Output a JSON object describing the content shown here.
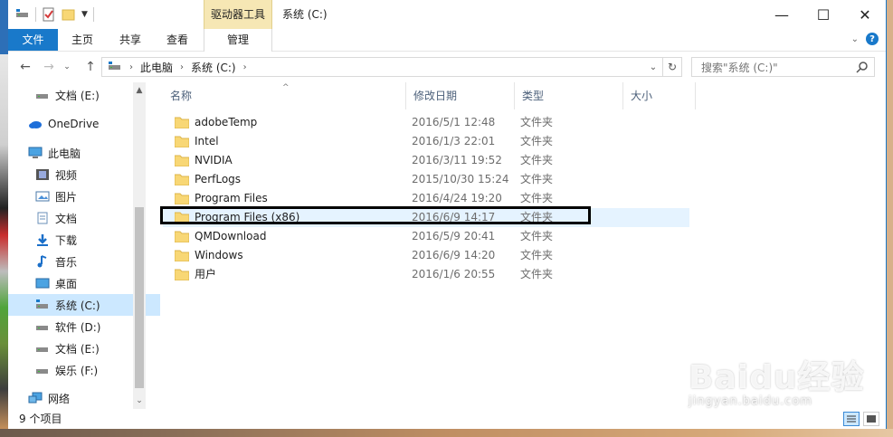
{
  "window": {
    "title": "系统 (C:)",
    "context_tool_label": "驱动器工具",
    "buttons": {
      "minimize": "—",
      "maximize": "☐",
      "close": "✕"
    }
  },
  "ribbon": {
    "tabs": [
      "文件",
      "主页",
      "共享",
      "查看",
      "管理"
    ],
    "help": "?"
  },
  "address": {
    "crumbs": [
      "此电脑",
      "系统 (C:)"
    ]
  },
  "search": {
    "placeholder": "搜索\"系统 (C:)\""
  },
  "nav": {
    "items": [
      {
        "label": "文档 (E:)",
        "icon": "drive-icon"
      },
      {
        "label": "OneDrive",
        "icon": "cloud-icon"
      },
      {
        "label": "此电脑",
        "icon": "computer-icon"
      },
      {
        "label": "视频",
        "icon": "video-icon"
      },
      {
        "label": "图片",
        "icon": "picture-icon"
      },
      {
        "label": "文档",
        "icon": "document-icon"
      },
      {
        "label": "下载",
        "icon": "download-icon"
      },
      {
        "label": "音乐",
        "icon": "music-icon"
      },
      {
        "label": "桌面",
        "icon": "desktop-icon"
      },
      {
        "label": "系统 (C:)",
        "icon": "system-drive-icon",
        "selected": true
      },
      {
        "label": "软件 (D:)",
        "icon": "drive-icon"
      },
      {
        "label": "文档 (E:)",
        "icon": "drive-icon"
      },
      {
        "label": "娱乐 (F:)",
        "icon": "drive-icon"
      },
      {
        "label": "网络",
        "icon": "network-icon"
      }
    ]
  },
  "columns": [
    "名称",
    "修改日期",
    "类型",
    "大小"
  ],
  "files": [
    {
      "name": "adobeTemp",
      "date": "2016/5/1 12:48",
      "type": "文件夹"
    },
    {
      "name": "Intel",
      "date": "2016/1/3 22:01",
      "type": "文件夹"
    },
    {
      "name": "NVIDIA",
      "date": "2016/3/11 19:52",
      "type": "文件夹"
    },
    {
      "name": "PerfLogs",
      "date": "2015/10/30 15:24",
      "type": "文件夹"
    },
    {
      "name": "Program Files",
      "date": "2016/4/24 19:20",
      "type": "文件夹"
    },
    {
      "name": "Program Files (x86)",
      "date": "2016/6/9 14:17",
      "type": "文件夹",
      "highlighted": true
    },
    {
      "name": "QMDownload",
      "date": "2016/5/9 20:41",
      "type": "文件夹"
    },
    {
      "name": "Windows",
      "date": "2016/6/9 14:20",
      "type": "文件夹"
    },
    {
      "name": "用户",
      "date": "2016/1/6 20:55",
      "type": "文件夹"
    }
  ],
  "status": {
    "count_text": "9 个项目"
  },
  "watermark": {
    "brand": "Baidu经验",
    "url": "jingyan.baidu.com"
  },
  "colors": {
    "accent": "#1979ca",
    "selection": "#cce8ff",
    "hover": "#e5f3ff",
    "context_tab": "#f6e7b4",
    "folder": "#f8d775"
  }
}
